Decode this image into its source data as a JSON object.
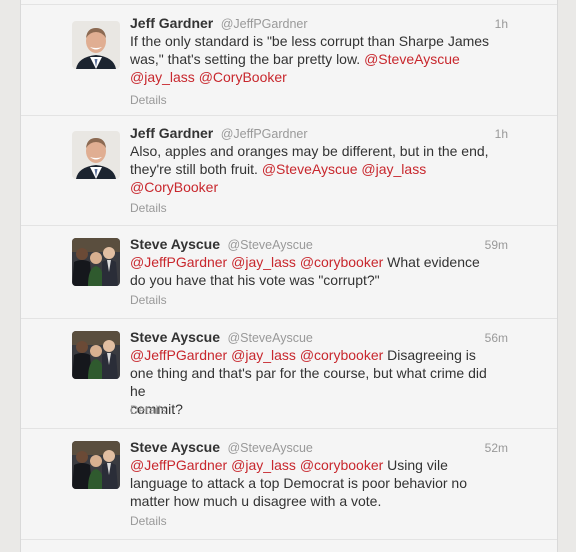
{
  "tweets": [
    {
      "name": "Jeff Gardner",
      "handle": "@JeffPGardner",
      "time": "1h",
      "avatar_icon": "jeff-gardner-avatar",
      "lines": [
        [
          {
            "t": "If the only standard is \"be less corrupt than Sharpe James"
          }
        ],
        [
          {
            "t": "was,\" that's setting the bar pretty low. "
          },
          {
            "t": "@SteveAyscue",
            "m": true
          }
        ],
        [
          {
            "t": "@jay_lass",
            "m": true
          },
          {
            "t": " "
          },
          {
            "t": "@CoryBooker",
            "m": true
          }
        ]
      ],
      "details": "Details"
    },
    {
      "name": "Jeff Gardner",
      "handle": "@JeffPGardner",
      "time": "1h",
      "avatar_icon": "jeff-gardner-avatar",
      "lines": [
        [
          {
            "t": "Also, apples and oranges may be different, but in the end,"
          }
        ],
        [
          {
            "t": "they're still both fruit. "
          },
          {
            "t": "@SteveAyscue",
            "m": true
          },
          {
            "t": " "
          },
          {
            "t": "@jay_lass",
            "m": true
          }
        ],
        [
          {
            "t": "@CoryBooker",
            "m": true
          }
        ]
      ],
      "details": "Details"
    },
    {
      "name": "Steve Ayscue",
      "handle": "@SteveAyscue",
      "time": "59m",
      "avatar_icon": "steve-ayscue-avatar",
      "lines": [
        [
          {
            "t": "@JeffPGardner",
            "m": true
          },
          {
            "t": " "
          },
          {
            "t": "@jay_lass",
            "m": true
          },
          {
            "t": " "
          },
          {
            "t": "@corybooker",
            "m": true
          },
          {
            "t": " What evidence"
          }
        ],
        [
          {
            "t": "do you have that his vote was \"corrupt?\""
          }
        ]
      ],
      "details": "Details"
    },
    {
      "name": "Steve Ayscue",
      "handle": "@SteveAyscue",
      "time": "56m",
      "avatar_icon": "steve-ayscue-avatar",
      "lines": [
        [
          {
            "t": "@JeffPGardner",
            "m": true
          },
          {
            "t": " "
          },
          {
            "t": "@jay_lass",
            "m": true
          },
          {
            "t": " "
          },
          {
            "t": "@corybooker",
            "m": true
          },
          {
            "t": " Disagreeing is"
          }
        ],
        [
          {
            "t": "one thing and that's par for the course, but what crime did he"
          }
        ],
        [
          {
            "t": "commit?"
          }
        ]
      ],
      "details": "Details"
    },
    {
      "name": "Steve Ayscue",
      "handle": "@SteveAyscue",
      "time": "52m",
      "avatar_icon": "steve-ayscue-avatar",
      "lines": [
        [
          {
            "t": "@JeffPGardner",
            "m": true
          },
          {
            "t": " "
          },
          {
            "t": "@jay_lass",
            "m": true
          },
          {
            "t": " "
          },
          {
            "t": "@corybooker",
            "m": true
          },
          {
            "t": " Using vile"
          }
        ],
        [
          {
            "t": "language to attack a top Democrat is poor behavior no"
          }
        ],
        [
          {
            "t": "matter how much u disagree with a vote."
          }
        ]
      ],
      "details": "Details"
    }
  ],
  "colors": {
    "mention": "#c8272d",
    "name": "#333333",
    "muted": "#999999"
  }
}
